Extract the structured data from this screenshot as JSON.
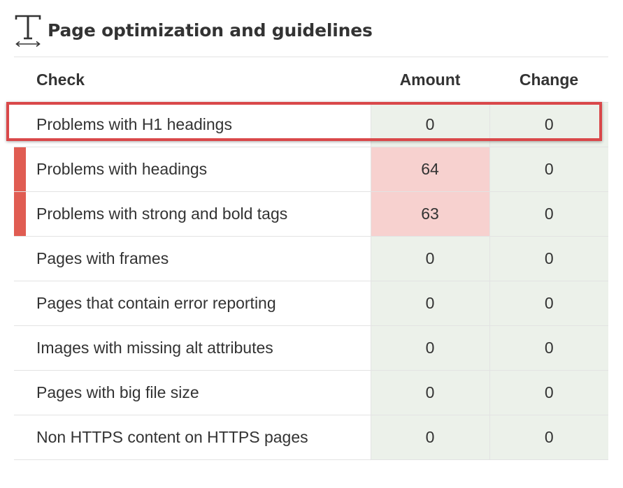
{
  "section": {
    "title": "Page optimization and guidelines",
    "icon": "text-size-icon"
  },
  "table": {
    "columns": {
      "check": "Check",
      "amount": "Amount",
      "change": "Change"
    },
    "rows": [
      {
        "label": "Problems with H1 headings",
        "amount": "0",
        "change": "0",
        "status": "ok",
        "highlighted": true
      },
      {
        "label": "Problems with headings",
        "amount": "64",
        "change": "0",
        "status": "error",
        "highlighted": false
      },
      {
        "label": "Problems with strong and bold tags",
        "amount": "63",
        "change": "0",
        "status": "error",
        "highlighted": false
      },
      {
        "label": "Pages with frames",
        "amount": "0",
        "change": "0",
        "status": "ok",
        "highlighted": false
      },
      {
        "label": "Pages that contain error reporting",
        "amount": "0",
        "change": "0",
        "status": "ok",
        "highlighted": false
      },
      {
        "label": "Images with missing alt attributes",
        "amount": "0",
        "change": "0",
        "status": "ok",
        "highlighted": false
      },
      {
        "label": "Pages with big file size",
        "amount": "0",
        "change": "0",
        "status": "ok",
        "highlighted": false
      },
      {
        "label": "Non HTTPS content on HTTPS pages",
        "amount": "0",
        "change": "0",
        "status": "ok",
        "highlighted": false
      }
    ]
  },
  "colors": {
    "ok_cell": "#ecf1ea",
    "error_cell": "#f7d1cf",
    "error_bar": "#e05c52",
    "highlight_border": "#d9484a"
  }
}
